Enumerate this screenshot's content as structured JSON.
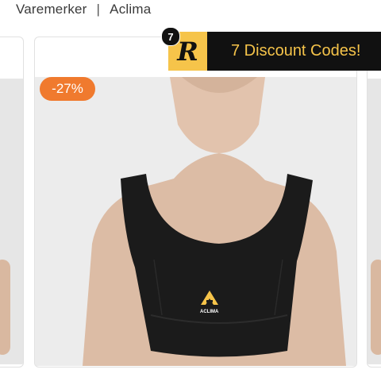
{
  "breadcrumb": {
    "root": "Varemerker",
    "separator": "|",
    "current": "Aclima"
  },
  "product": {
    "discount": "-27%",
    "image_icon": "sports-bra-photo",
    "brand_mark": "ACLIMA"
  },
  "promo": {
    "count": "7",
    "logo_letter": "R",
    "text": "7 Discount Codes!"
  },
  "colors": {
    "discount_badge": "#f07a2e",
    "promo_background": "#111111",
    "promo_accent": "#f6c44a"
  }
}
